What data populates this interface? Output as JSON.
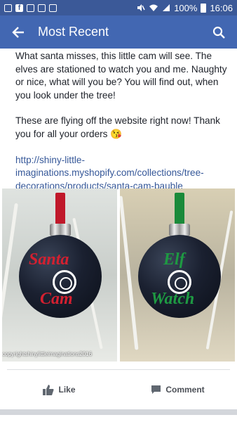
{
  "status_bar": {
    "battery": "100%",
    "time": "16:06",
    "icons": [
      "notification-icon",
      "facebook-icon",
      "gallery-icon",
      "mute-icon",
      "wifi-icon",
      "signal-icon",
      "battery-icon"
    ]
  },
  "app_bar": {
    "title": "Most Recent",
    "back_icon": "arrow-left-icon",
    "search_icon": "search-icon"
  },
  "post": {
    "paragraph1": "What santa misses, this little cam will see. The elves are stationed to watch you and me. Naughty or nice,  what will you be? You will find out, when you look under the tree!",
    "paragraph2": "These are flying off the website right now! Thank you for all your orders 😘",
    "link": "http://shiny-little-imaginations.myshopify.com/collections/tree-decorations/products/santa-cam-bauble",
    "photo_left": {
      "word1": "Santa",
      "word2": "Cam",
      "watermark": "copyrightshinylittleimaginations2016",
      "ribbon_color": "#c0182a",
      "text_color": "#d42030"
    },
    "photo_right": {
      "word1": "Elf",
      "word2": "Watch",
      "ribbon_color": "#1a8a3a",
      "text_color": "#1e9a42"
    }
  },
  "actions": {
    "like": "Like",
    "comment": "Comment"
  },
  "colors": {
    "facebook_blue": "#4267b2",
    "status_blue": "#3b5998",
    "link_blue": "#365899"
  }
}
